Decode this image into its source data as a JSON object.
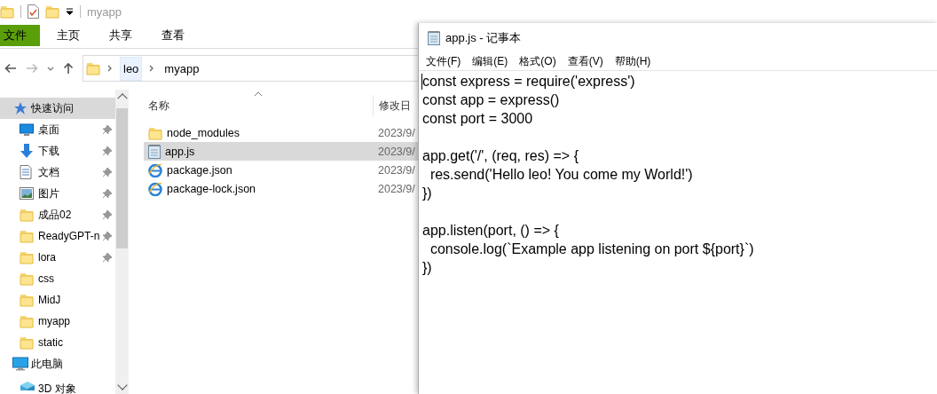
{
  "explorer": {
    "title": "myapp",
    "ribbon_tabs": [
      {
        "label": "文件",
        "selected": true
      },
      {
        "label": "主页",
        "selected": false
      },
      {
        "label": "共享",
        "selected": false
      },
      {
        "label": "查看",
        "selected": false
      }
    ],
    "breadcrumb": [
      "leo",
      "myapp"
    ],
    "sidebar": {
      "items": [
        {
          "label": "快速访问",
          "kind": "quickaccess",
          "pinned": false,
          "selected": true
        },
        {
          "label": "桌面",
          "kind": "desktop",
          "pinned": true,
          "selected": false
        },
        {
          "label": "下载",
          "kind": "downloads",
          "pinned": true,
          "selected": false
        },
        {
          "label": "文档",
          "kind": "documents",
          "pinned": true,
          "selected": false
        },
        {
          "label": "图片",
          "kind": "pictures",
          "pinned": true,
          "selected": false
        },
        {
          "label": "成品02",
          "kind": "folder",
          "pinned": true,
          "selected": false
        },
        {
          "label": "ReadyGPT-n",
          "kind": "folder",
          "pinned": true,
          "selected": false
        },
        {
          "label": "lora",
          "kind": "folder",
          "pinned": true,
          "selected": false
        },
        {
          "label": "css",
          "kind": "folder",
          "pinned": false,
          "selected": false
        },
        {
          "label": "MidJ",
          "kind": "folder",
          "pinned": false,
          "selected": false
        },
        {
          "label": "myapp",
          "kind": "folder",
          "pinned": false,
          "selected": false
        },
        {
          "label": "static",
          "kind": "folder",
          "pinned": false,
          "selected": false
        },
        {
          "label": "此电脑",
          "kind": "computer",
          "pinned": false,
          "selected": false
        },
        {
          "label": "3D 对象",
          "kind": "objects",
          "pinned": false,
          "selected": false
        }
      ]
    },
    "file_list": {
      "columns": [
        "名称",
        "修改日"
      ],
      "rows": [
        {
          "name": "node_modules",
          "kind": "folder",
          "modified": "2023/9/",
          "selected": false
        },
        {
          "name": "app.js",
          "kind": "text",
          "modified": "2023/9/",
          "selected": true
        },
        {
          "name": "package.json",
          "kind": "json",
          "modified": "2023/9/",
          "selected": false
        },
        {
          "name": "package-lock.json",
          "kind": "json",
          "modified": "2023/9/",
          "selected": false
        }
      ]
    }
  },
  "notepad": {
    "title": "app.js - 记事本",
    "menu": [
      "文件(F)",
      "编辑(E)",
      "格式(O)",
      "查看(V)",
      "帮助(H)"
    ],
    "text": "const express = require('express')\nconst app = express()\nconst port = 3000\n\napp.get('/', (req, res) => {\n  res.send('Hello leo! You come my World!')\n})\n\napp.listen(port, () => {\n  console.log(`Example app listening on port ${port}`)\n})"
  }
}
